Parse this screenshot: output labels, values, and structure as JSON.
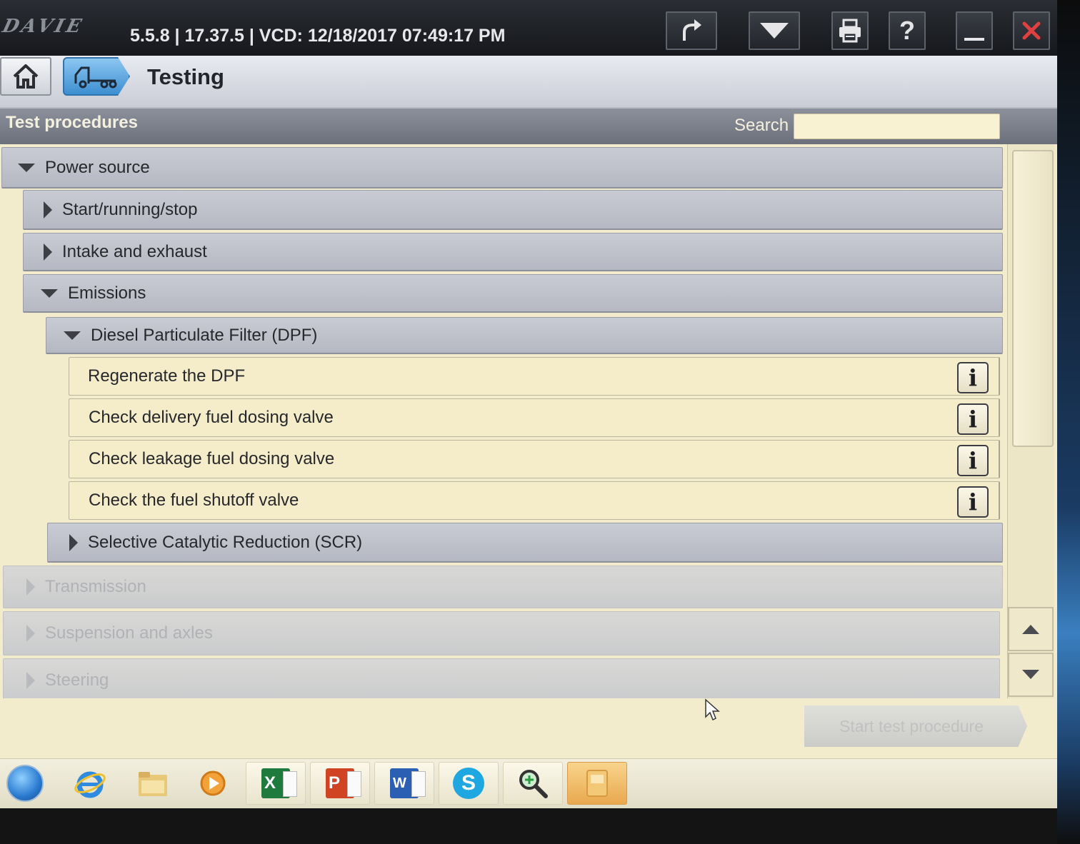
{
  "titlebar": {
    "logo": "DAVIE",
    "version": "5.5.8 | 17.37.5 | VCD: 12/18/2017 07:49:17 PM",
    "buttons": [
      {
        "icon": "redo-arrow-icon"
      },
      {
        "icon": "dropdown-triangle-icon"
      },
      {
        "icon": "printer-icon"
      },
      {
        "icon": "help-icon",
        "label": "?"
      },
      {
        "icon": "minimize-icon"
      },
      {
        "icon": "close-icon"
      }
    ],
    "close_color": "#e04040"
  },
  "nav": {
    "home_icon": "home-icon",
    "vehicle_icon": "vehicle-icon",
    "title": "Testing"
  },
  "section": {
    "title": "Test procedures",
    "search_label": "Search",
    "search_value": "",
    "search_placeholder": ""
  },
  "tree": {
    "items": [
      {
        "label": "Power source",
        "level": 0,
        "state": "expanded",
        "type": "group"
      },
      {
        "label": "Start/running/stop",
        "level": 1,
        "state": "collapsed",
        "type": "group"
      },
      {
        "label": "Intake and exhaust",
        "level": 1,
        "state": "collapsed",
        "type": "group"
      },
      {
        "label": "Emissions",
        "level": 1,
        "state": "expanded",
        "type": "group"
      },
      {
        "label": "Diesel Particulate Filter (DPF)",
        "level": 2,
        "state": "expanded",
        "type": "group"
      },
      {
        "label": "Regenerate the DPF",
        "level": 3,
        "type": "procedure",
        "info": "i"
      },
      {
        "label": "Check delivery fuel dosing valve",
        "level": 3,
        "type": "procedure",
        "info": "i"
      },
      {
        "label": "Check leakage fuel dosing valve",
        "level": 3,
        "type": "procedure",
        "info": "i"
      },
      {
        "label": "Check the fuel shutoff valve",
        "level": 3,
        "type": "procedure",
        "info": "i"
      },
      {
        "label": "Selective Catalytic Reduction (SCR)",
        "level": 2,
        "state": "collapsed",
        "type": "group"
      },
      {
        "label": "Transmission",
        "level": 0,
        "state": "collapsed",
        "type": "group",
        "disabled": true
      },
      {
        "label": "Suspension and axles",
        "level": 0,
        "state": "collapsed",
        "type": "group",
        "disabled": true
      },
      {
        "label": "Steering",
        "level": 0,
        "state": "collapsed",
        "type": "group",
        "disabled": true
      }
    ]
  },
  "scrollbar": {
    "up_icon": "scroll-up-arrow-icon",
    "down_icon": "scroll-down-arrow-icon"
  },
  "actions": {
    "start_label": "Start test procedure",
    "start_disabled": true
  },
  "taskbar": {
    "items": [
      {
        "icon": "windows-start-orb-icon"
      },
      {
        "icon": "internet-explorer-icon"
      },
      {
        "icon": "file-explorer-icon"
      },
      {
        "icon": "media-player-icon"
      },
      {
        "icon": "excel-icon",
        "letter": "X"
      },
      {
        "icon": "powerpoint-icon",
        "letter": "P"
      },
      {
        "icon": "word-icon",
        "letter": "W"
      },
      {
        "icon": "skype-icon",
        "letter": "S"
      },
      {
        "icon": "magnifier-icon"
      },
      {
        "icon": "davie-app-icon"
      }
    ]
  }
}
